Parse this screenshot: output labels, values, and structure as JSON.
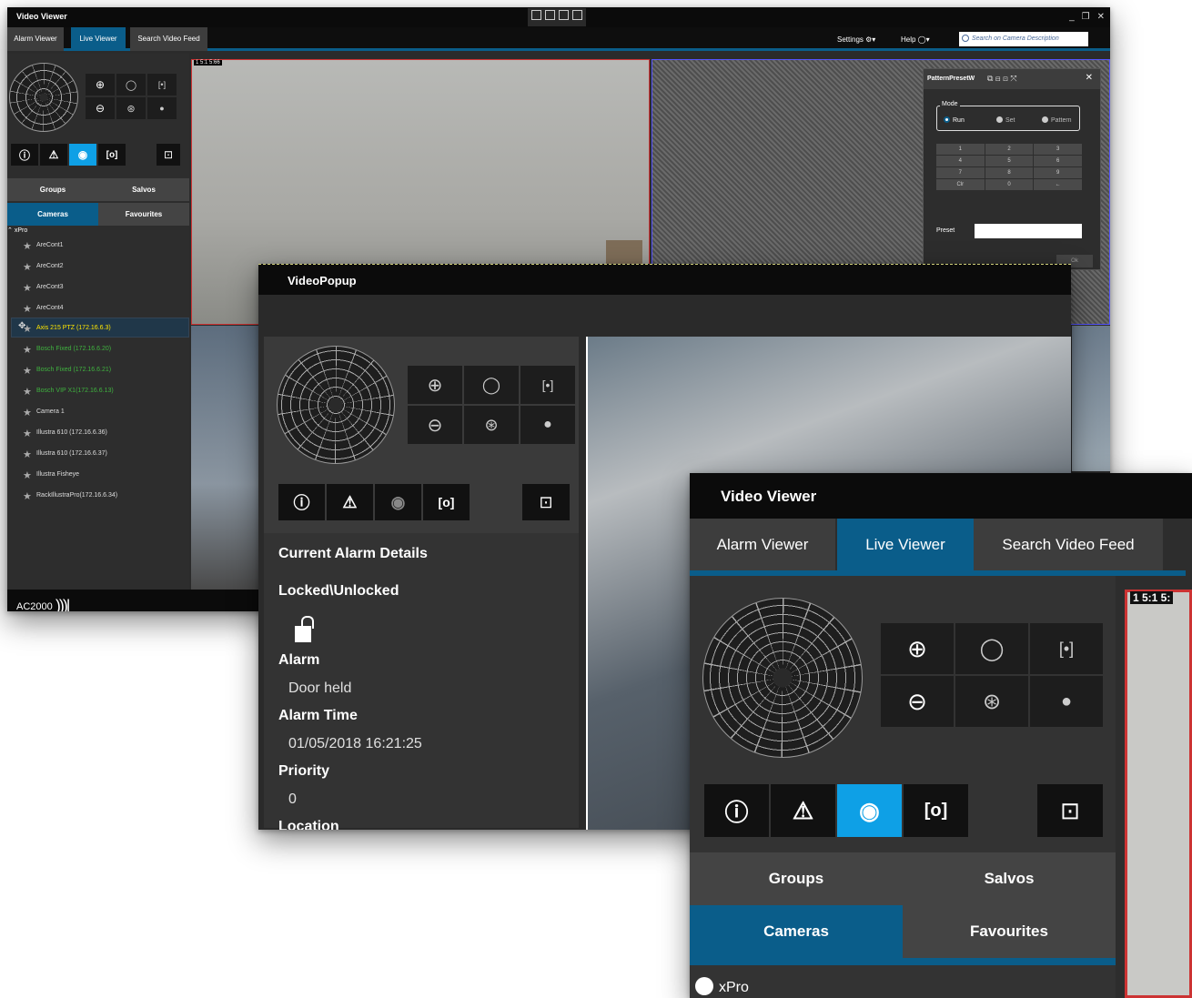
{
  "main": {
    "title": "Video Viewer",
    "tabs": [
      "Alarm Viewer",
      "Live Viewer",
      "Search Video Feed"
    ],
    "settings": "Settings",
    "help": "Help",
    "search_placeholder": "Search on Camera Description",
    "groups": "Groups",
    "salvos": "Salvos",
    "cameras": "Cameras",
    "favourites": "Favourites",
    "root": "xPro",
    "cameras_list": [
      "AreCont1",
      "AreCont2",
      "AreCont3",
      "AreCont4",
      "Axis 215 PTZ (172.16.6.3)",
      "Bosch Fixed (172.16.6.20)",
      "Bosch Fixed (172.16.6.21)",
      "Bosch VIP X1(172.16.6.13)",
      "Camera 1",
      "Illustra 610 (172.16.6.36)",
      "Illustra 610 (172.16.6.37)",
      "Illustra Fisheye",
      "RackIllustraPro(172.16.6.34)"
    ],
    "status_label": "AC2000",
    "video_label": "1 5:1 5:66"
  },
  "pattern": {
    "title": "PatternPresetW",
    "mode": "Mode",
    "run": "Run",
    "set": "Set",
    "pattern": "Pattern",
    "keys": [
      "1",
      "2",
      "3",
      "4",
      "5",
      "6",
      "7",
      "8",
      "9",
      "Clr",
      "0",
      "←"
    ],
    "preset": "Preset",
    "ok": "Ok"
  },
  "popup": {
    "title": "VideoPopup",
    "details_heading": "Current Alarm Details",
    "locked_heading": "Locked\\Unlocked",
    "alarm_heading": "Alarm",
    "alarm_value": "Door held",
    "alarm_time_heading": "Alarm Time",
    "alarm_time_value": "01/05/2018 16:21:25",
    "priority_heading": "Priority",
    "priority_value": "0",
    "location_heading": "Location"
  },
  "zoom": {
    "title": "Video Viewer",
    "tabs": [
      "Alarm Viewer",
      "Live Viewer",
      "Search Video Feed"
    ],
    "groups": "Groups",
    "salvos": "Salvos",
    "cameras": "Cameras",
    "favourites": "Favourites",
    "root": "xPro",
    "video_label": "1 5:1 5:"
  },
  "colors": {
    "accent": "#0a5d8a",
    "active_tool": "#0ea0e6",
    "selected_camera": "#ffe600",
    "offline_camera": "#3fb23f"
  }
}
